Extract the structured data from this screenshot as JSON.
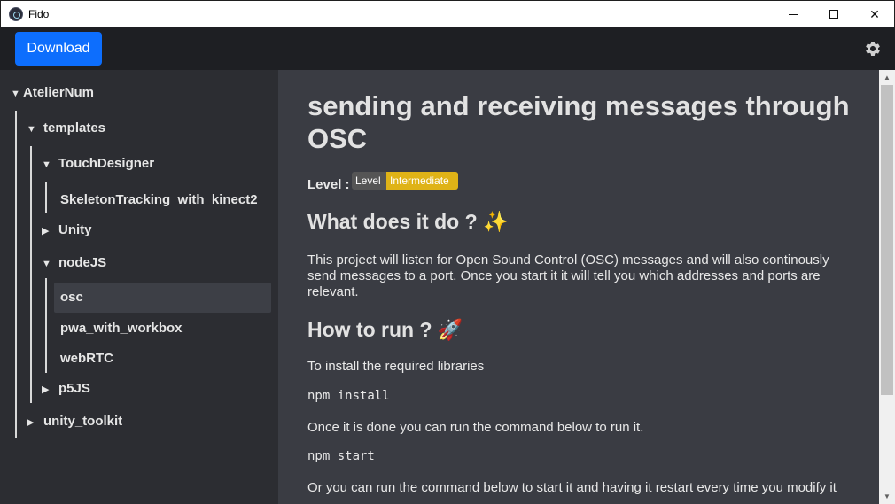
{
  "window": {
    "title": "Fido",
    "minimize_icon": "minimize-icon",
    "maximize_icon": "maximize-icon",
    "close_glyph": "✕"
  },
  "toolbar": {
    "download_label": "Download",
    "settings_icon": "gear-icon",
    "accent_color": "#0d6efd"
  },
  "sidebar": {
    "tree": [
      {
        "label": "AtelierNum",
        "caret": "▼"
      },
      {
        "label": "templates",
        "caret": "▼"
      },
      {
        "label": "TouchDesigner",
        "caret": "▼"
      },
      {
        "label": "SkeletonTracking_with_kinect2",
        "caret": ""
      },
      {
        "label": "Unity",
        "caret": "▶"
      },
      {
        "label": "nodeJS",
        "caret": "▼"
      },
      {
        "label": "osc",
        "caret": "",
        "selected": true
      },
      {
        "label": "pwa_with_workbox",
        "caret": ""
      },
      {
        "label": "webRTC",
        "caret": ""
      },
      {
        "label": "p5JS",
        "caret": "▶"
      },
      {
        "label": "unity_toolkit",
        "caret": "▶"
      }
    ]
  },
  "content": {
    "title": "sending and receiving messages through OSC",
    "level_label": "Level :",
    "badge_left": "Level",
    "badge_right": "Intermediate",
    "badge_color": "#dfb317",
    "what_heading": "What does it do ? ✨",
    "what_text": "This project will listen for Open Sound Control (OSC) messages and will also continously send messages to a port. Once you start it it will tell you which addresses and ports are relevant.",
    "how_heading": "How to run ? 🚀",
    "install_text": "To install the required libraries",
    "install_cmd": "npm install",
    "run_text": "Once it is done you can run the command below to run it.",
    "run_cmd": "npm start",
    "restart_text": "Or you can run the command below to start it and having it restart every time you modify it"
  },
  "scrollbar": {
    "up_glyph": "▲",
    "down_glyph": "▼"
  }
}
